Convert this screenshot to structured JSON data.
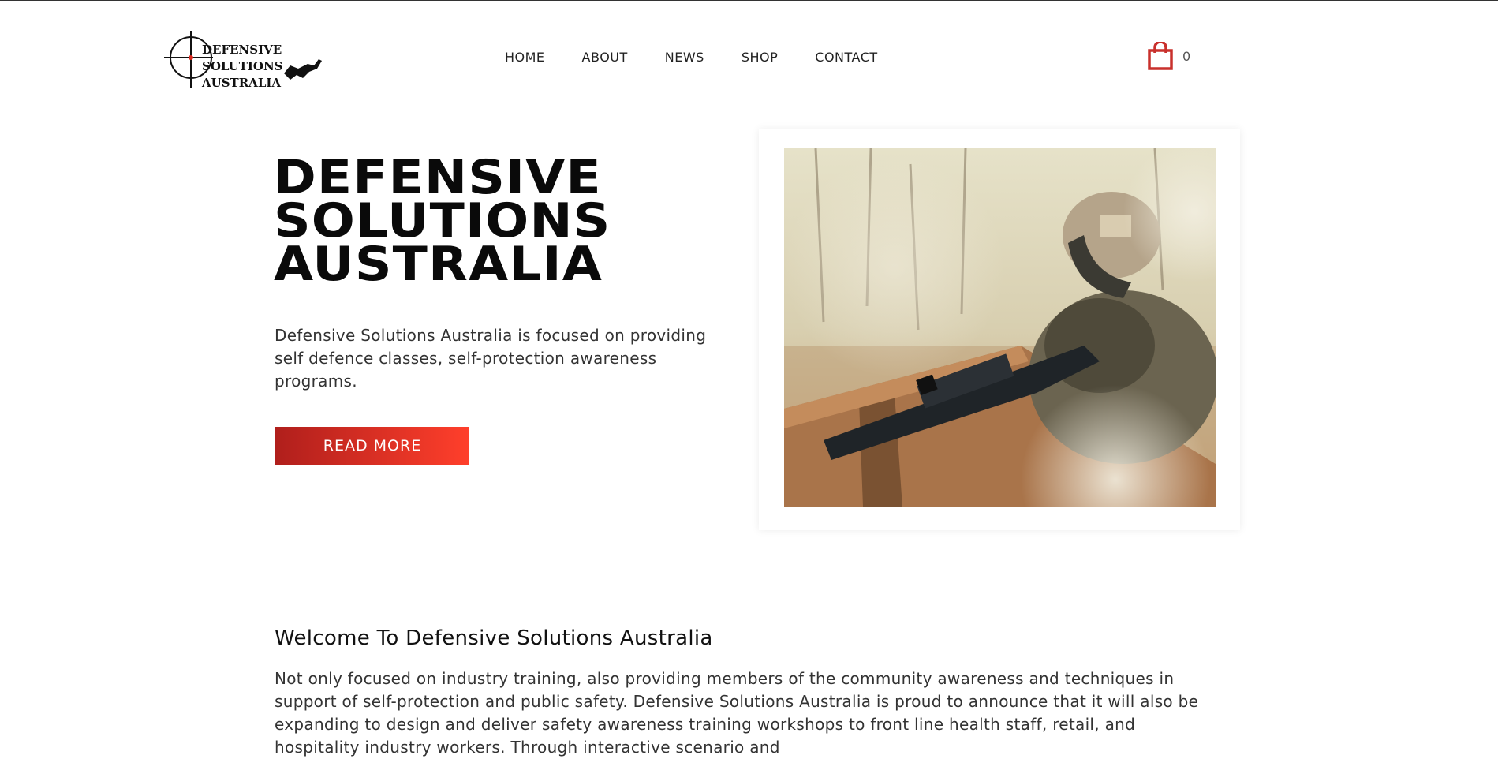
{
  "brand": {
    "logo_line1": "DEFENSIVE SOLUTIONS",
    "logo_line2": "AUSTRALIA"
  },
  "nav": {
    "items": [
      {
        "label": "HOME"
      },
      {
        "label": "ABOUT"
      },
      {
        "label": "NEWS"
      },
      {
        "label": "SHOP"
      },
      {
        "label": "CONTACT"
      }
    ]
  },
  "cart": {
    "count": "0",
    "icon": "shopping-bag-icon",
    "color": "#c9302c"
  },
  "hero": {
    "title_line1": "DEFENSIVE",
    "title_line2": "SOLUTIONS",
    "title_line3": "AUSTRALIA",
    "description": "Defensive Solutions Australia is focused on providing self defence classes, self-protection awareness programs.",
    "button_label": "READ MORE",
    "accent_start": "#b01f1c",
    "accent_end": "#ff3f2b"
  },
  "welcome": {
    "title": "Welcome To Defensive Solutions Australia",
    "body": "Not only focused on industry training, also providing members of the community awareness and techniques in support of self-protection and public safety. Defensive Solutions Australia is proud to announce that it will also be expanding to design and deliver safety awareness training workshops to front line health staff, retail, and hospitality industry workers. Through interactive scenario and"
  }
}
